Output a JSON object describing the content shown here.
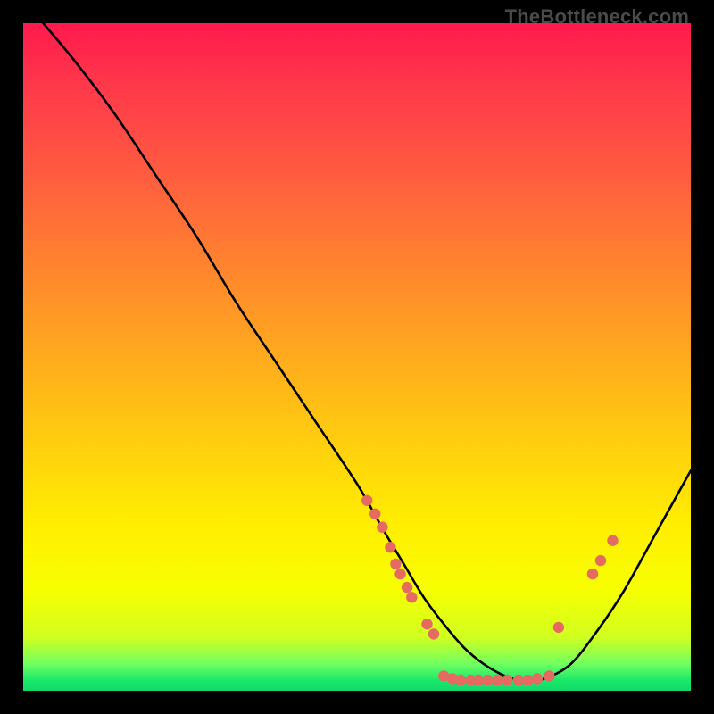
{
  "attribution": "TheBottleneck.com",
  "colors": {
    "page_bg": "#000000",
    "curve": "#000000",
    "points": "#e46a62",
    "gradient_top": "#ff1a4d",
    "gradient_bottom": "#12d86a"
  },
  "chart_data": {
    "type": "line",
    "title": "",
    "xlabel": "",
    "ylabel": "",
    "xlim": [
      0,
      100
    ],
    "ylim": [
      0,
      100
    ],
    "grid": false,
    "legend": false,
    "curve": {
      "x": [
        3,
        8,
        14,
        20,
        26,
        32,
        38,
        44,
        50,
        54,
        57,
        60,
        63,
        66,
        69,
        72,
        75,
        78,
        82,
        86,
        90,
        95,
        100
      ],
      "y": [
        100,
        94,
        86,
        77,
        68,
        58,
        49,
        40,
        31,
        24,
        19,
        14,
        10,
        6.5,
        4,
        2.3,
        1.5,
        1.8,
        4,
        9,
        15,
        24,
        33
      ]
    },
    "points": [
      {
        "x": 51.5,
        "y": 28.5
      },
      {
        "x": 52.7,
        "y": 26.5
      },
      {
        "x": 53.8,
        "y": 24.5
      },
      {
        "x": 55.0,
        "y": 21.5
      },
      {
        "x": 55.8,
        "y": 19.0
      },
      {
        "x": 56.5,
        "y": 17.5
      },
      {
        "x": 57.5,
        "y": 15.5
      },
      {
        "x": 58.2,
        "y": 14.0
      },
      {
        "x": 60.5,
        "y": 10.0
      },
      {
        "x": 61.5,
        "y": 8.5
      },
      {
        "x": 63.0,
        "y": 2.2
      },
      {
        "x": 64.3,
        "y": 1.8
      },
      {
        "x": 65.5,
        "y": 1.6
      },
      {
        "x": 67.0,
        "y": 1.6
      },
      {
        "x": 68.2,
        "y": 1.6
      },
      {
        "x": 69.6,
        "y": 1.6
      },
      {
        "x": 71.0,
        "y": 1.6
      },
      {
        "x": 72.5,
        "y": 1.6
      },
      {
        "x": 74.2,
        "y": 1.6
      },
      {
        "x": 75.6,
        "y": 1.6
      },
      {
        "x": 77.0,
        "y": 1.8
      },
      {
        "x": 78.8,
        "y": 2.2
      },
      {
        "x": 80.2,
        "y": 9.5
      },
      {
        "x": 85.3,
        "y": 17.5
      },
      {
        "x": 86.5,
        "y": 19.5
      },
      {
        "x": 88.3,
        "y": 22.5
      }
    ]
  }
}
